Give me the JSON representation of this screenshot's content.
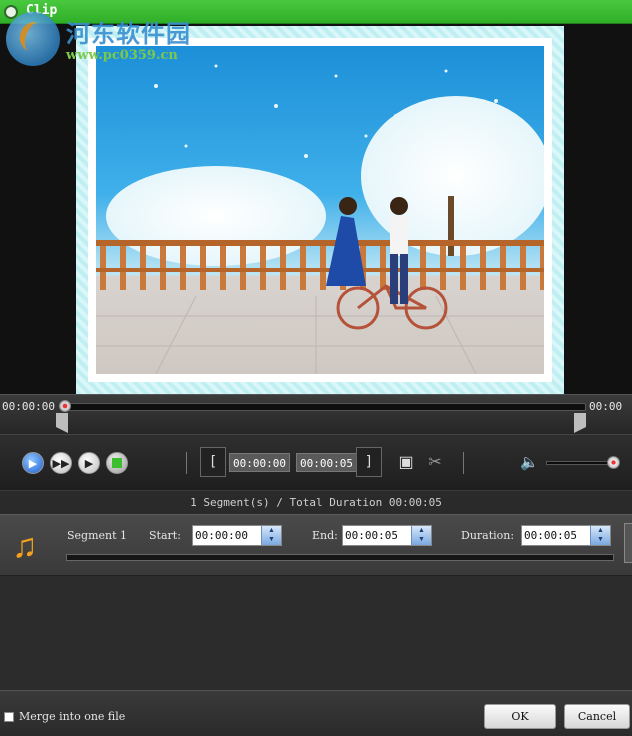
{
  "window": {
    "title": "Clip"
  },
  "watermark": {
    "site_name": "河东软件园",
    "url": "www.pc0359.cn"
  },
  "timeline": {
    "current_time": "00:00:00",
    "end_time": "00:00",
    "playhead_position": 0
  },
  "controls": {
    "start_time": "00:00:00",
    "end_time": "00:00:05",
    "volume_level": 1.0
  },
  "summary": {
    "text": "1 Segment(s) / Total Duration 00:00:05"
  },
  "segment": {
    "name": "Segment 1",
    "start_label": "Start:",
    "start_value": "00:00:00",
    "end_label": "End:",
    "end_value": "00:00:05",
    "duration_label": "Duration:",
    "duration_value": "00:00:05"
  },
  "footer": {
    "merge_label": "Merge into one file",
    "merge_checked": false,
    "ok_label": "OK",
    "cancel_label": "Cancel"
  },
  "icons": {
    "play": "play-icon",
    "fast_forward": "fast-forward-icon",
    "step": "step-forward-icon",
    "stop": "stop-icon",
    "filmstrip": "filmstrip-icon",
    "cut": "scissors-icon",
    "volume": "speaker-icon",
    "music": "music-note-icon"
  },
  "colors": {
    "titlebar": "#39bd30",
    "play_button": "#1e5fd0",
    "music_icon": "#f3a01c"
  }
}
